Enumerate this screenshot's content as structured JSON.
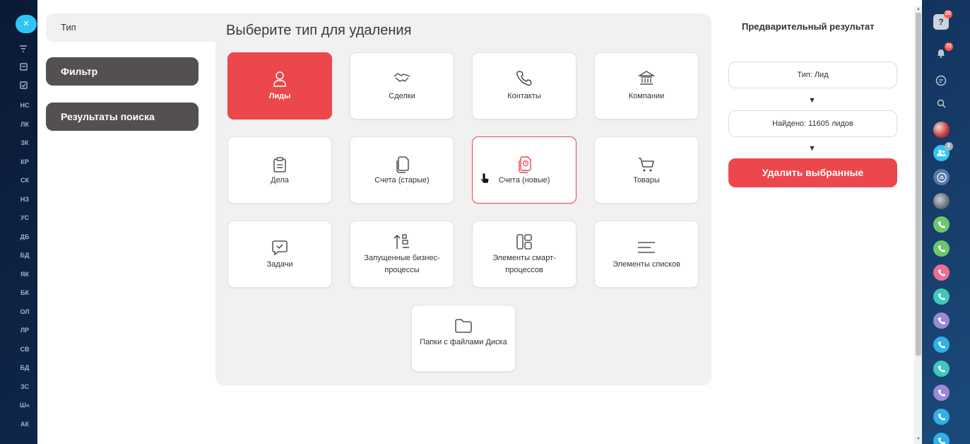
{
  "left_nav": {
    "close_label": "×",
    "icons": [
      "filter-icon",
      "list-icon",
      "checkbox-icon"
    ],
    "items": [
      "НС",
      "ЛК",
      "ЗК",
      "КР",
      "СК",
      "НЗ",
      "УС",
      "ДБ",
      "БД",
      "ЯК",
      "БК",
      "ОЛ",
      "ЛР",
      "СВ",
      "БД",
      "ЗС",
      "Ш«",
      "АК"
    ]
  },
  "sidebar": {
    "type_label": "Тип",
    "filter_label": "Фильтр",
    "results_label": "Результаты поиска"
  },
  "main": {
    "title": "Выберите тип для удаления",
    "tiles": [
      {
        "label": "Лиды",
        "icon": "person-icon"
      },
      {
        "label": "Сделки",
        "icon": "handshake-icon"
      },
      {
        "label": "Контакты",
        "icon": "phone-icon"
      },
      {
        "label": "Компании",
        "icon": "bank-icon"
      },
      {
        "label": "Дела",
        "icon": "clipboard-icon"
      },
      {
        "label": "Счета (старые)",
        "icon": "documents-icon"
      },
      {
        "label": "Счета (новые)",
        "icon": "document-clock-icon"
      },
      {
        "label": "Товары",
        "icon": "cart-icon"
      },
      {
        "label": "Задачи",
        "icon": "chat-check-icon"
      },
      {
        "label": "Запущенные бизнес-процессы",
        "icon": "sort-icon"
      },
      {
        "label": "Элементы смарт-процессов",
        "icon": "layout-icon"
      },
      {
        "label": "Элементы списков",
        "icon": "lines-icon"
      },
      {
        "label": "Папки с файлами Диска",
        "icon": "folder-icon"
      }
    ]
  },
  "result": {
    "title": "Предварительный результат",
    "type_text": "Тип: Лид",
    "found_text": "Найдено: 11605 лидов",
    "arrow": "▼",
    "delete_label": "Удалить выбранные"
  },
  "rail": {
    "help_badge": "25",
    "bell_badge": "72",
    "group_badge": "2"
  },
  "colors": {
    "accent": "#ec474c",
    "dark_step": "#545050",
    "rail_blue": "#2fc6f6"
  }
}
